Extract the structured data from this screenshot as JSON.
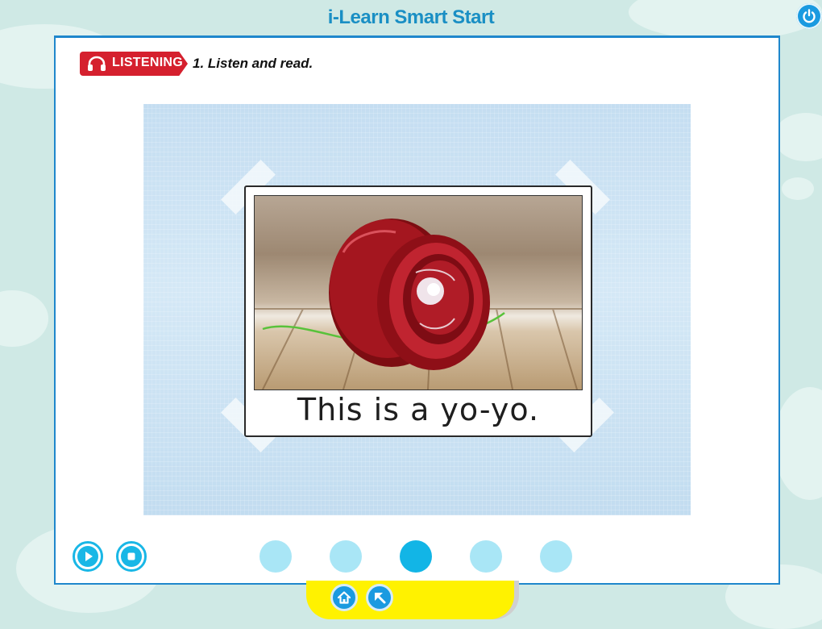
{
  "app": {
    "title": "i-Learn Smart Start"
  },
  "activity": {
    "banner_label": "LISTENING",
    "instruction": "1. Listen and read."
  },
  "card": {
    "caption": "This is a yo-yo."
  },
  "pagination": {
    "total": 5,
    "active_index": 2
  },
  "colors": {
    "accent": "#19b7e6",
    "banner_red": "#d5202e",
    "title_blue": "#1a8fc4",
    "tab_yellow": "#fff200",
    "background": "#cfe9e5"
  },
  "icons": {
    "power": "power-icon",
    "headphones": "headphones-icon",
    "play": "play-icon",
    "stop": "stop-icon",
    "home": "home-icon",
    "back": "back-arrow-icon"
  }
}
